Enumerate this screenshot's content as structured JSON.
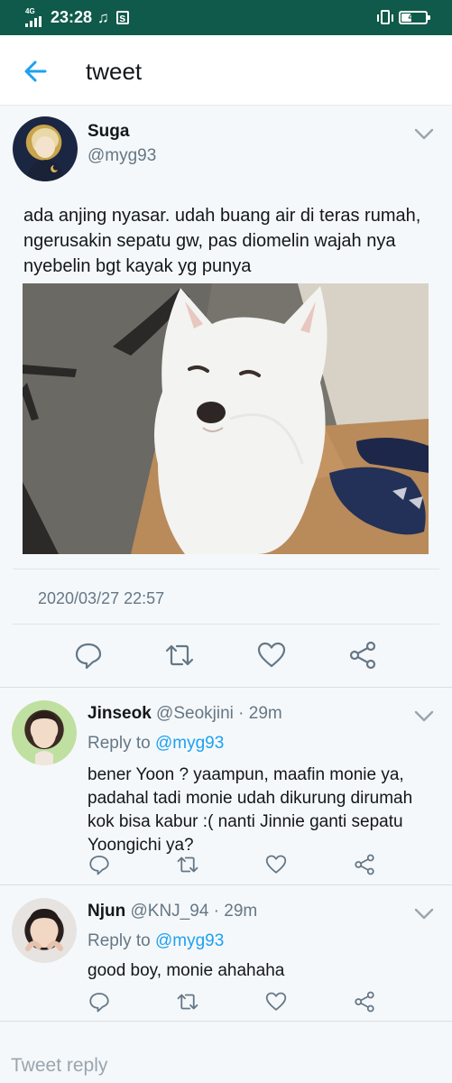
{
  "status_bar": {
    "network": "4G",
    "time": "23:28",
    "battery": "41",
    "battery_level": 0.41
  },
  "header": {
    "title": "tweet",
    "back_icon": "arrow-left-icon"
  },
  "colors": {
    "accent": "#1da1f2",
    "status_bar": "#0f5a4a",
    "secondary_text": "#657786"
  },
  "tweet": {
    "display_name": "Suga",
    "handle": "@myg93",
    "text": "ada anjing nyasar. udah buang air di teras rumah, ngerusakin sepatu gw, pas diomelin wajah nya nyebelin bgt kayak yg punya",
    "timestamp": "2020/03/27 22:57",
    "actions": [
      "reply-icon",
      "retweet-icon",
      "like-icon",
      "share-icon"
    ]
  },
  "replies": [
    {
      "display_name": "Jinseok",
      "handle": "@Seokjini",
      "age": " · 29m",
      "reply_to_label": "Reply to ",
      "reply_to_handle": "@myg93",
      "text": "bener Yoon ? yaampun, maafin monie ya, padahal tadi monie udah dikurung dirumah kok bisa kabur :( nanti Jinnie ganti sepatu Yoongichi ya?"
    },
    {
      "display_name": "Njun",
      "handle": "@KNJ_94",
      "age": " · 29m",
      "reply_to_label": "Reply to ",
      "reply_to_handle": "@myg93",
      "text": "good boy, monie ahahaha"
    }
  ],
  "composer": {
    "placeholder": "Tweet reply"
  }
}
